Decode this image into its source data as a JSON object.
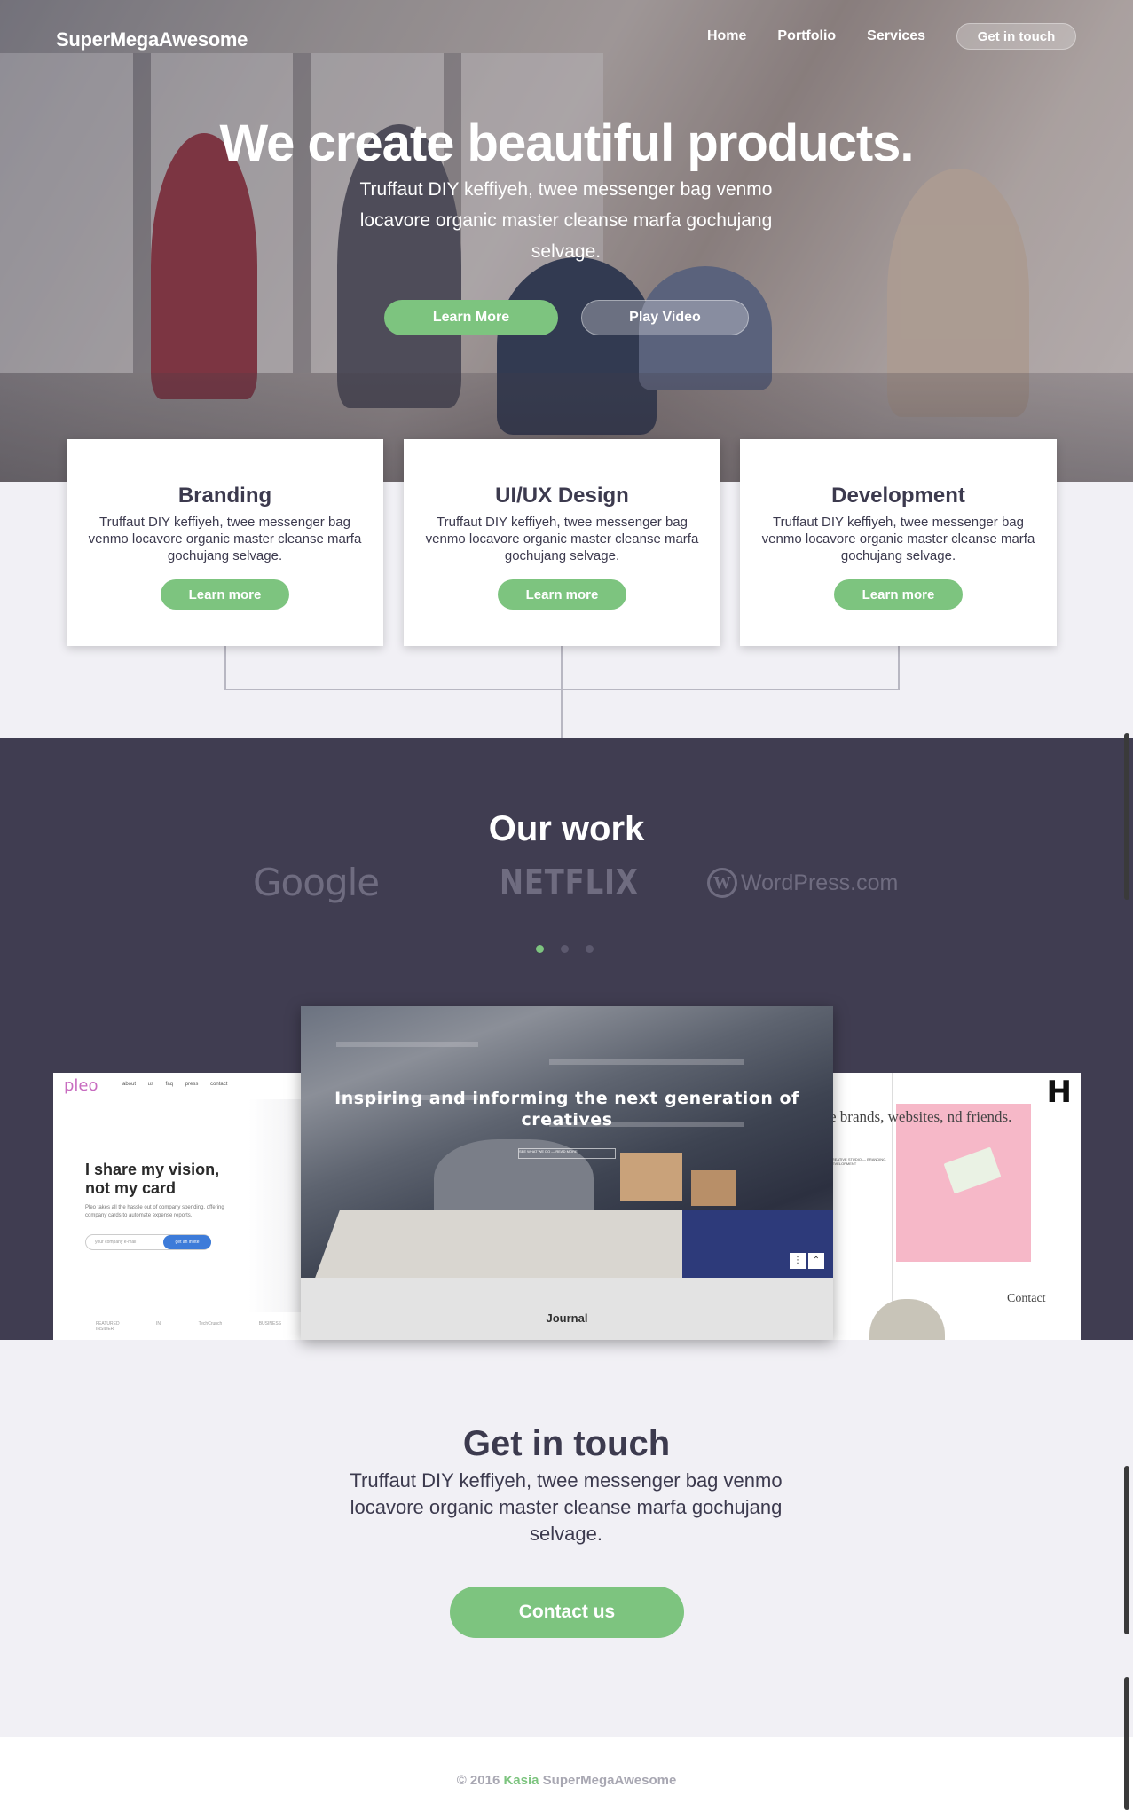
{
  "nav": {
    "brand": "SuperMegaAwesome",
    "links": [
      "Home",
      "Portfolio",
      "Services"
    ],
    "cta": "Get in touch"
  },
  "hero": {
    "title": "We create beautiful products.",
    "subtitle": "Truffaut DIY keffiyeh, twee messenger bag venmo locavore organic master cleanse marfa gochujang selvage.",
    "primary_button": "Learn More",
    "secondary_button": "Play Video"
  },
  "services": [
    {
      "title": "Branding",
      "text": "Truffaut DIY keffiyeh, twee messenger bag venmo locavore organic master cleanse marfa gochujang selvage.",
      "button": "Learn more"
    },
    {
      "title": "UI/UX Design",
      "text": "Truffaut DIY keffiyeh, twee messenger bag venmo locavore organic master cleanse marfa gochujang selvage.",
      "button": "Learn more"
    },
    {
      "title": "Development",
      "text": "Truffaut DIY keffiyeh, twee messenger bag venmo locavore organic master cleanse marfa gochujang selvage.",
      "button": "Learn more"
    }
  ],
  "work": {
    "title": "Our work",
    "clients": [
      "Google",
      "NETFLIX",
      "WordPress.com"
    ],
    "carousel_active_index": 0,
    "carousel_count": 3,
    "left_shot": {
      "logo": "pleo",
      "nav": "about us  faq  press  contact",
      "headline": "I share my vision, not my card",
      "body": "Pleo takes all the hassle out of company spending, offering company cards to automate expense reports.",
      "input_placeholder": "your company e-mail",
      "button": "get an invite",
      "featured": "FEATURED IN:  TechCrunch  BUSINESS INSIDER"
    },
    "center_shot": {
      "headline": "Inspiring and informing the next generation of creatives",
      "mini": "SEE WHAT WE DO — READ MORE",
      "caption": "Journal"
    },
    "right_shot": {
      "logo": "H",
      "text": "e brands, websites, nd friends.",
      "small": "CREATIVE STUDIO — BRANDING, DEVELOPMENT",
      "contact": "Contact"
    }
  },
  "contact": {
    "title": "Get in touch",
    "subtitle": "Truffaut DIY keffiyeh, twee messenger bag venmo locavore organic master cleanse marfa gochujang selvage.",
    "button": "Contact us"
  },
  "footer": {
    "copyright": "© 2016",
    "author": "Kasia",
    "brand": "SuperMegaAwesome"
  },
  "colors": {
    "accent": "#7dc47f",
    "dark_section": "#403d51",
    "text": "#3c3a4e",
    "page_bg": "#f1f0f5"
  }
}
